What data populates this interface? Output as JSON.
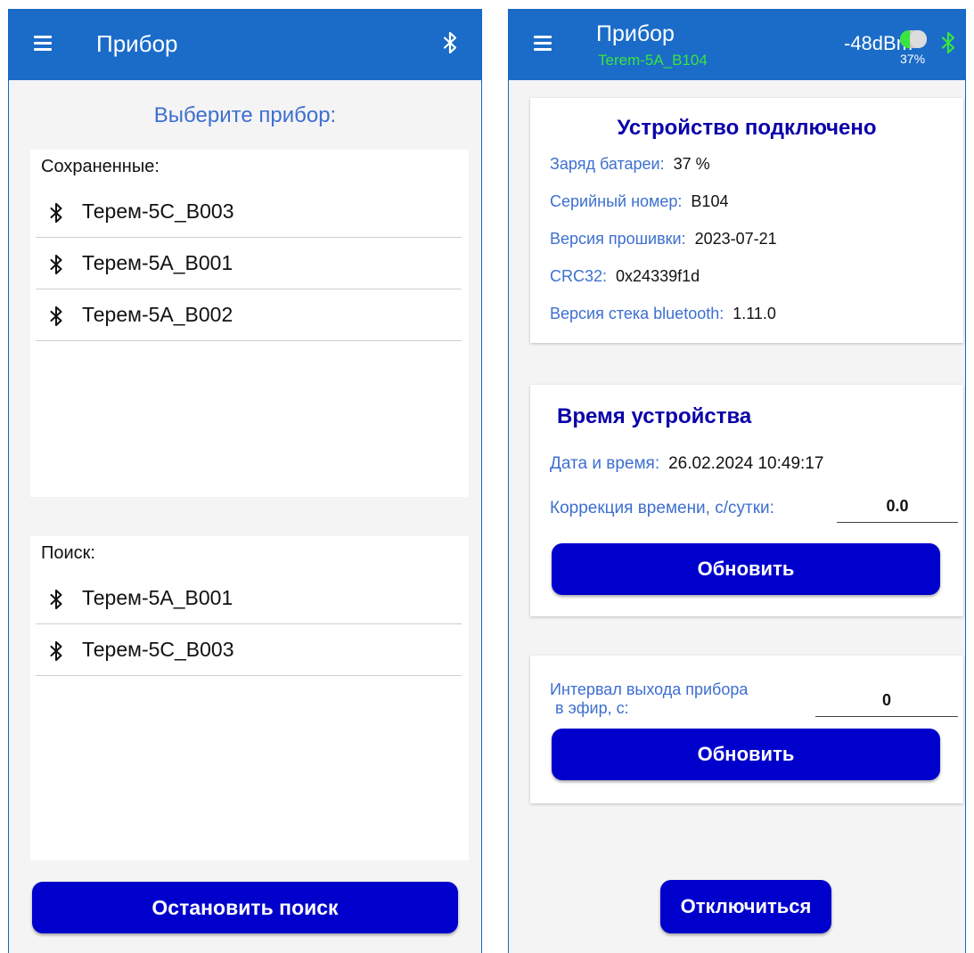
{
  "left": {
    "appbar": {
      "title": "Прибор"
    },
    "select_title": "Выберите прибор:",
    "saved": {
      "label": "Сохраненные:",
      "items": [
        {
          "name": "Терем-5C_B003"
        },
        {
          "name": "Терем-5A_B001"
        },
        {
          "name": "Терем-5A_B002"
        }
      ]
    },
    "search": {
      "label": "Поиск:",
      "items": [
        {
          "name": "Терем-5A_B001"
        },
        {
          "name": "Терем-5C_B003"
        }
      ]
    },
    "stop_button": "Остановить поиск"
  },
  "right": {
    "appbar": {
      "title": "Прибор",
      "device": "Terem-5A_B104",
      "rssi": "-48dBm",
      "battery_pct_label": "37%",
      "battery_level": 0.37
    },
    "info_card": {
      "title": "Устройство подключено",
      "rows": [
        {
          "key": "Заряд батареи:",
          "value": "37 %"
        },
        {
          "key": "Серийный номер:",
          "value": "B104"
        },
        {
          "key": "Версия прошивки:",
          "value": "2023-07-21"
        },
        {
          "key": "CRC32:",
          "value": "0x24339f1d"
        },
        {
          "key": "Версия стека bluetooth:",
          "value": "1.11.0"
        }
      ]
    },
    "time_card": {
      "title": "Время устройства",
      "datetime_key": "Дата и время:",
      "datetime_value": "26.02.2024 10:49:17",
      "correction_key": "Коррекция времени, с/сутки:",
      "correction_value": "0.0",
      "update_button": "Обновить"
    },
    "interval_card": {
      "label_line1": "Интервал выхода прибора",
      "label_line2": "в эфир, с:",
      "value": "0",
      "update_button": "Обновить"
    },
    "disconnect_button": "Отключиться"
  },
  "colors": {
    "appbar": "#1b6cc8",
    "button": "#0000cc",
    "label_blue": "#3d6fd0",
    "title_dark_blue": "#0a00a8",
    "accent_green": "#39e53e"
  },
  "icons": {
    "menu": "hamburger-menu-icon",
    "bluetooth": "bluetooth-icon"
  }
}
